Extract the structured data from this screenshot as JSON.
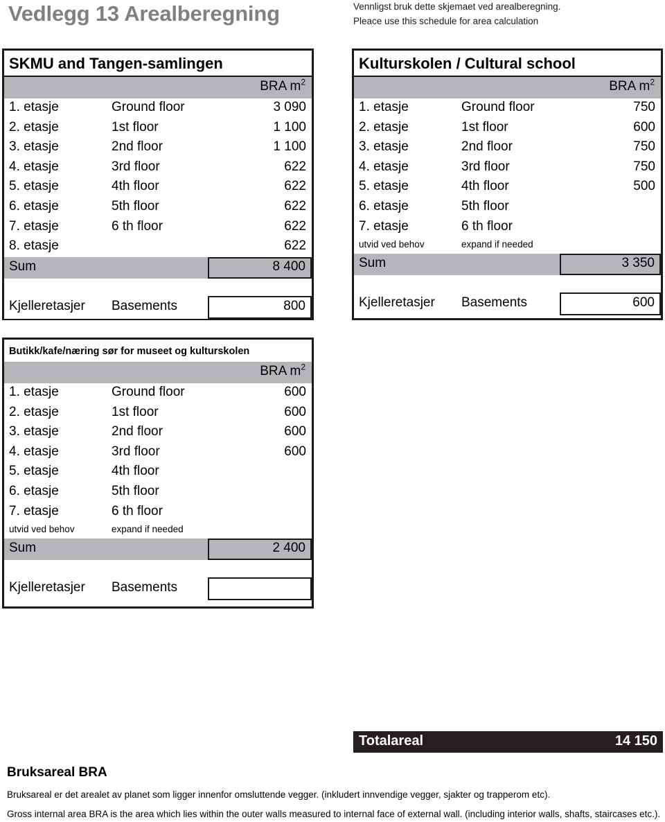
{
  "page_title": "Vedlegg 13 Arealberegning",
  "notes": {
    "norwegian": "Vennligst bruk dette skjemaet ved arealberegning.",
    "english": "Pleace use this schedule for area calculation"
  },
  "bra_header": "BRA m",
  "bra_superscript": "2",
  "tables": [
    {
      "title": "SKMU and Tangen-samlingen",
      "rows": [
        {
          "no": "1. etasje",
          "en": "Ground floor",
          "value": "3 090"
        },
        {
          "no": "2. etasje",
          "en": "1st floor",
          "value": "1 100"
        },
        {
          "no": "3. etasje",
          "en": "2nd floor",
          "value": "1 100"
        },
        {
          "no": "4. etasje",
          "en": "3rd floor",
          "value": "622"
        },
        {
          "no": "5. etasje",
          "en": "4th floor",
          "value": "622"
        },
        {
          "no": "6. etasje",
          "en": "5th floor",
          "value": "622"
        },
        {
          "no": "7. etasje",
          "en": "6 th floor",
          "value": "622"
        },
        {
          "no": "8. etasje",
          "en": "",
          "value": "622"
        }
      ],
      "sum_label": "Sum",
      "sum_value": "8 400",
      "basement_no": "Kjelleretasjer",
      "basement_en": "Basements",
      "basement_value": "800"
    },
    {
      "title": "Kulturskolen / Cultural school",
      "rows": [
        {
          "no": "1. etasje",
          "en": "Ground floor",
          "value": "750"
        },
        {
          "no": "2. etasje",
          "en": "1st floor",
          "value": "600"
        },
        {
          "no": "3. etasje",
          "en": "2nd floor",
          "value": "750"
        },
        {
          "no": "4. etasje",
          "en": "3rd floor",
          "value": "750"
        },
        {
          "no": "5. etasje",
          "en": "4th floor",
          "value": "500"
        },
        {
          "no": "6. etasje",
          "en": "5th floor",
          "value": ""
        },
        {
          "no": "7. etasje",
          "en": "6 th floor",
          "value": ""
        }
      ],
      "expand_no": "utvid ved behov",
      "expand_en": "expand if needed",
      "sum_label": "Sum",
      "sum_value": "3 350",
      "basement_no": "Kjelleretasjer",
      "basement_en": "Basements",
      "basement_value": "600"
    },
    {
      "title": "Butikk/kafe/næring sør for museet og kulturskolen",
      "rows": [
        {
          "no": "1. etasje",
          "en": "Ground floor",
          "value": "600"
        },
        {
          "no": "2. etasje",
          "en": "1st floor",
          "value": "600"
        },
        {
          "no": "3. etasje",
          "en": "2nd floor",
          "value": "600"
        },
        {
          "no": "4. etasje",
          "en": "3rd floor",
          "value": "600"
        },
        {
          "no": "5. etasje",
          "en": "4th floor",
          "value": ""
        },
        {
          "no": "6. etasje",
          "en": "5th floor",
          "value": ""
        },
        {
          "no": "7. etasje",
          "en": "6 th floor",
          "value": ""
        }
      ],
      "expand_no": "utvid ved behov",
      "expand_en": "expand if needed",
      "sum_label": "Sum",
      "sum_value": "2 400",
      "basement_no": "Kjelleretasjer",
      "basement_en": "Basements",
      "basement_value": ""
    }
  ],
  "total": {
    "label": "Totalareal",
    "value": "14 150"
  },
  "footer": {
    "heading": "Bruksareal BRA",
    "line_no": "Bruksareal  er det arealet av planet som ligger innenfor omsluttende vegger. (inkludert innvendige vegger, sjakter og trapperom etc).",
    "line_en": "Gross internal area BRA  is the area which lies within the outer walls measured to internal face of external wall. (including interior walls, shafts, staircases etc.)."
  },
  "colors": {
    "header_gray": "#b5b6ba",
    "title_gray": "#808080",
    "total_bar": "#231f20",
    "border": "#1a1a1a"
  }
}
